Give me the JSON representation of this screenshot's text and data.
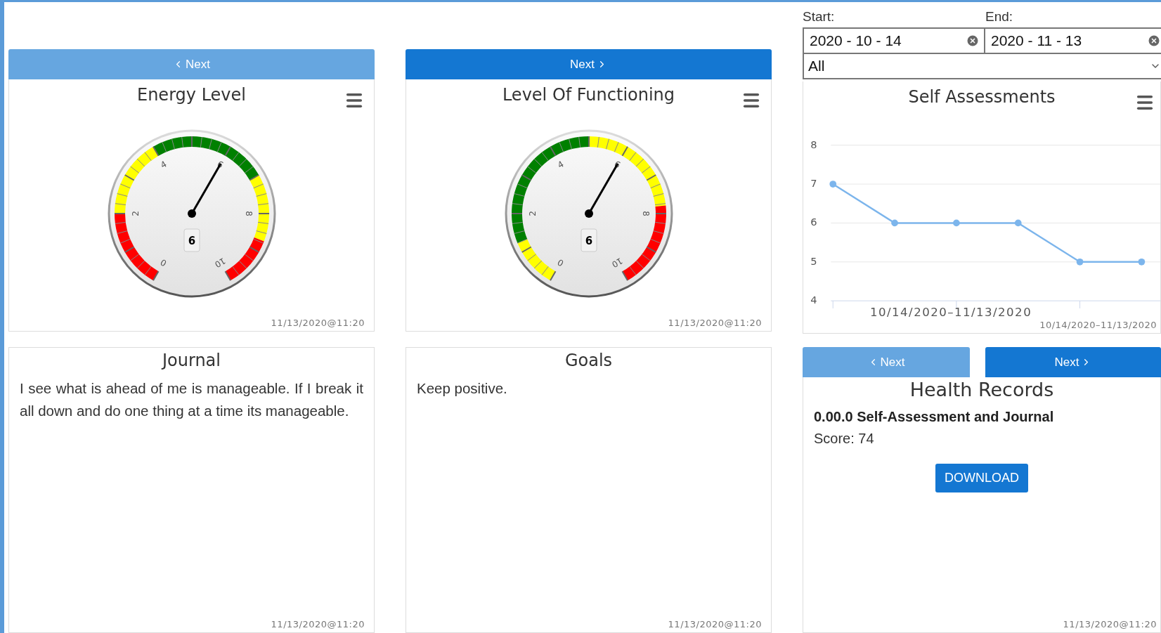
{
  "top_nav": [
    {
      "kind": "prev",
      "label": "Next"
    },
    {
      "kind": "next",
      "label": "Next"
    }
  ],
  "filters": {
    "start_label": "Start:",
    "end_label": "End:",
    "start_value": "2020 - 10 - 14",
    "end_value": "2020 - 11 - 13",
    "category": "All"
  },
  "gauges": [
    {
      "title": "Energy Level",
      "value": "6",
      "scale_labels": [
        "0",
        "2",
        "4",
        "6",
        "8",
        "10"
      ],
      "bands": [
        {
          "color": "#ff0000"
        },
        {
          "color": "#ffff00"
        },
        {
          "color": "#008000"
        },
        {
          "color": "#ffff00"
        },
        {
          "color": "#ff0000"
        }
      ],
      "timestamp": "11/13/2020@11:20"
    },
    {
      "title": "Level Of Functioning",
      "value": "6",
      "scale_labels": [
        "0",
        "2",
        "4",
        "6",
        "8",
        "10"
      ],
      "bands": [
        {
          "color": "#ffff00"
        },
        {
          "color": "#008000"
        },
        {
          "color": "#ffff00"
        },
        {
          "color": "#ff0000"
        }
      ],
      "timestamp": "11/13/2020@11:20"
    }
  ],
  "self_assessments": {
    "chart_data": {
      "type": "line",
      "title": "Self Assessments",
      "xlabel": "10/14/2020–11/13/2020",
      "ylim": [
        4,
        8
      ],
      "yticks": [
        4,
        5,
        6,
        7,
        8
      ],
      "grid": true,
      "series": [
        {
          "color": "#7cb5ec",
          "marker": true,
          "values": [
            7,
            6,
            6,
            6,
            5,
            5
          ]
        }
      ]
    },
    "credit": "10/14/2020–11/13/2020"
  },
  "journal": {
    "title": "Journal",
    "text": "I see what is ahead of me is manageable. If I break it all down and do one thing at a time its manageable.",
    "timestamp": "11/13/2020@11:20"
  },
  "goals": {
    "title": "Goals",
    "text": "Keep positive.",
    "timestamp": "11/13/2020@11:20"
  },
  "records_nav": [
    {
      "kind": "prev",
      "label": "Next"
    },
    {
      "kind": "next",
      "label": "Next"
    }
  ],
  "health_records": {
    "title": "Health Records",
    "entry_title": "0.00.0 Self-Assessment and Journal",
    "score": "Score: 74",
    "button": "DOWNLOAD",
    "timestamp": "11/13/2020@11:20"
  }
}
